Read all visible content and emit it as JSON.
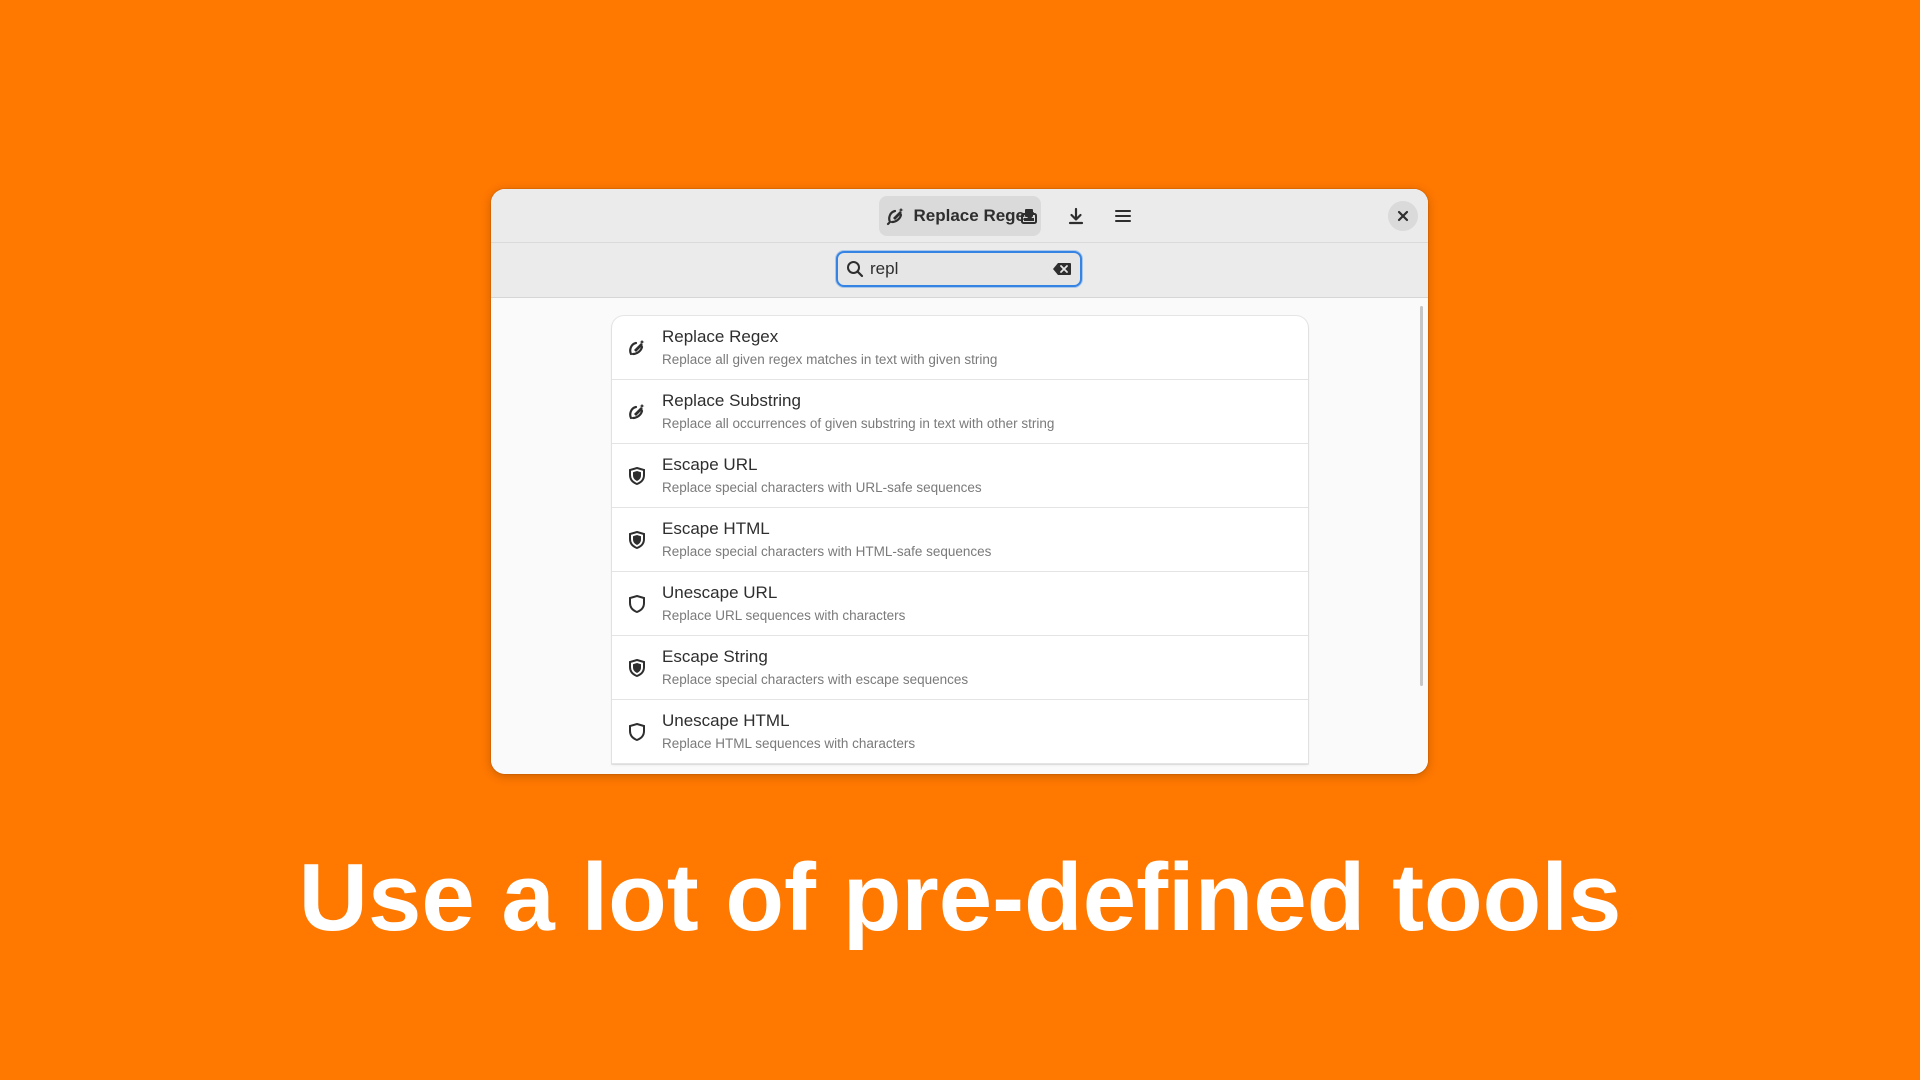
{
  "window": {
    "title": "Replace Regex",
    "title_icon": "replace-icon",
    "header_buttons": [
      {
        "name": "paste-icon"
      },
      {
        "name": "download-icon"
      },
      {
        "name": "menu-icon"
      },
      {
        "name": "close-icon"
      }
    ]
  },
  "search": {
    "value": "repl",
    "icon": "search-icon",
    "clear_icon": "clear-icon"
  },
  "tools": [
    {
      "title": "Replace Regex",
      "subtitle": "Replace all given regex matches in text with given string",
      "icon": "replace-icon"
    },
    {
      "title": "Replace Substring",
      "subtitle": "Replace all occurrences of given substring in text with other string",
      "icon": "replace-icon"
    },
    {
      "title": "Escape URL",
      "subtitle": "Replace special characters with URL-safe sequences",
      "icon": "shield-filled-icon"
    },
    {
      "title": "Escape HTML",
      "subtitle": "Replace special characters with HTML-safe sequences",
      "icon": "shield-filled-icon"
    },
    {
      "title": "Unescape URL",
      "subtitle": "Replace URL sequences with characters",
      "icon": "shield-outline-icon"
    },
    {
      "title": "Escape String",
      "subtitle": "Replace special characters with escape sequences",
      "icon": "shield-filled-icon"
    },
    {
      "title": "Unescape HTML",
      "subtitle": "Replace HTML sequences with characters",
      "icon": "shield-outline-icon"
    }
  ],
  "headline": "Use a lot of pre-defined tools",
  "colors": {
    "background": "#FF7800",
    "accent": "#3584e4"
  }
}
